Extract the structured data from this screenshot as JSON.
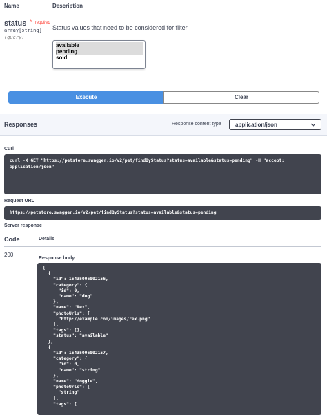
{
  "params_table": {
    "col_name": "Name",
    "col_description": "Description"
  },
  "parameter": {
    "name": "status",
    "required_marker": "*",
    "required_label": "required",
    "type": "array[string]",
    "location": "(query)",
    "description": "Status values that need to be considered for filter",
    "options": [
      "available",
      "pending",
      "sold"
    ],
    "selected": [
      "available",
      "pending"
    ]
  },
  "actions": {
    "execute_label": "Execute",
    "clear_label": "Clear"
  },
  "responses": {
    "title": "Responses",
    "content_type_label": "Response content type",
    "content_type_value": "application/json"
  },
  "curl": {
    "label": "Curl",
    "line1": "curl -X GET \"https://petstore.swagger.io/v2/pet/findByStatus?status=available&status=pending\" -H \"accept:",
    "line2": "application/json\""
  },
  "request_url": {
    "label": "Request URL",
    "value": "https://petstore.swagger.io/v2/pet/findByStatus?status=available&status=pending"
  },
  "server_response": {
    "label": "Server response",
    "col_code": "Code",
    "col_details": "Details",
    "code": "200",
    "body_label": "Response body",
    "body_lines": [
      "[",
      "  {",
      "    \"id\": 15435006002156,",
      "    \"category\": {",
      "      \"id\": 0,",
      "      \"name\": \"dog\"",
      "    },",
      "    \"name\": \"Rex\",",
      "    \"photoUrls\": [",
      "      \"http://example.com/images/rex.png\"",
      "    ],",
      "    \"tags\": [],",
      "    \"status\": \"available\"",
      "  },",
      "  {",
      "    \"id\": 15435006002157,",
      "    \"category\": {",
      "      \"id\": 0,",
      "      \"name\": \"string\"",
      "    },",
      "    \"name\": \"doggie\",",
      "    \"photoUrls\": [",
      "      \"string\"",
      "    ],",
      "    \"tags\": ["
    ]
  }
}
